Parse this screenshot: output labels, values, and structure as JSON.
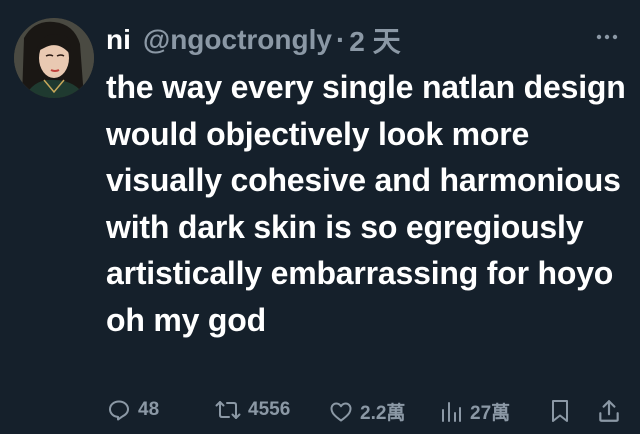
{
  "tweet": {
    "display_name": "ni",
    "handle": "@ngoctrongly",
    "separator": "·",
    "time": "2 天",
    "body": "the way every single natlan design would objectively look more visually cohesive and harmonious with dark skin is so egregiously artistically embarrassing for hoyo oh my god"
  },
  "actions": {
    "reply": {
      "icon": "reply-icon",
      "count": "48"
    },
    "retweet": {
      "icon": "retweet-icon",
      "count": "4556"
    },
    "like": {
      "icon": "heart-icon",
      "count": "2.2萬"
    },
    "views": {
      "icon": "views-icon",
      "count": "27萬"
    },
    "bookmark": {
      "icon": "bookmark-icon"
    },
    "share": {
      "icon": "share-icon"
    }
  },
  "colors": {
    "background": "#15202b",
    "text": "#ffffff",
    "muted": "#8b98a5"
  }
}
